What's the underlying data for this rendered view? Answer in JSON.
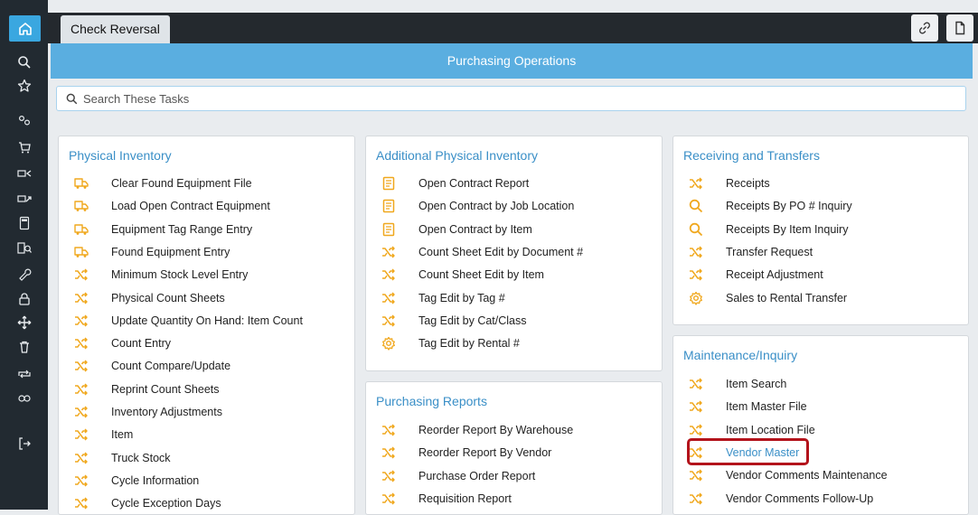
{
  "window": {
    "tab_title": "Check Reversal"
  },
  "header": {
    "title": "Purchasing Operations"
  },
  "search": {
    "placeholder": "Search These Tasks"
  },
  "colors": {
    "accent": "#3a8fc7",
    "band": "#5aaee0",
    "icon": "#f0a81e",
    "highlight": "#b3131b",
    "sidebar": "#222a31"
  },
  "panels": {
    "physical_inventory": {
      "title": "Physical Inventory",
      "items": [
        {
          "label": "Clear Found Equipment File",
          "icon": "truck-icon"
        },
        {
          "label": "Load Open Contract Equipment",
          "icon": "truck-icon"
        },
        {
          "label": "Equipment Tag Range Entry",
          "icon": "truck-icon"
        },
        {
          "label": "Found Equipment Entry",
          "icon": "truck-icon"
        },
        {
          "label": "Minimum Stock Level Entry",
          "icon": "shuffle-icon"
        },
        {
          "label": "Physical Count Sheets",
          "icon": "shuffle-icon"
        },
        {
          "label": "Update Quantity On Hand: Item Count",
          "icon": "shuffle-icon"
        },
        {
          "label": "Count Entry",
          "icon": "shuffle-icon"
        },
        {
          "label": "Count Compare/Update",
          "icon": "shuffle-icon"
        },
        {
          "label": "Reprint Count Sheets",
          "icon": "shuffle-icon"
        },
        {
          "label": "Inventory Adjustments",
          "icon": "shuffle-icon"
        },
        {
          "label": "Item",
          "icon": "shuffle-icon"
        },
        {
          "label": "Truck Stock",
          "icon": "shuffle-icon"
        },
        {
          "label": "Cycle Information",
          "icon": "shuffle-icon"
        },
        {
          "label": "Cycle Exception Days",
          "icon": "shuffle-icon"
        }
      ]
    },
    "additional_physical_inventory": {
      "title": "Additional Physical Inventory",
      "items": [
        {
          "label": "Open Contract Report",
          "icon": "report-icon"
        },
        {
          "label": "Open Contract by Job Location",
          "icon": "report-icon"
        },
        {
          "label": "Open Contract by Item",
          "icon": "report-icon"
        },
        {
          "label": "Count Sheet Edit by Document #",
          "icon": "shuffle-icon"
        },
        {
          "label": "Count Sheet Edit by Item",
          "icon": "shuffle-icon"
        },
        {
          "label": "Tag Edit by Tag #",
          "icon": "shuffle-icon"
        },
        {
          "label": "Tag Edit by Cat/Class",
          "icon": "shuffle-icon"
        },
        {
          "label": "Tag Edit by Rental #",
          "icon": "gear-icon"
        }
      ]
    },
    "purchasing_reports": {
      "title": "Purchasing Reports",
      "items": [
        {
          "label": "Reorder Report By Warehouse",
          "icon": "shuffle-icon"
        },
        {
          "label": "Reorder Report By Vendor",
          "icon": "shuffle-icon"
        },
        {
          "label": "Purchase Order Report",
          "icon": "shuffle-icon"
        },
        {
          "label": "Requisition Report",
          "icon": "shuffle-icon"
        }
      ]
    },
    "receiving_transfers": {
      "title": "Receiving and Transfers",
      "items": [
        {
          "label": "Receipts",
          "icon": "shuffle-icon"
        },
        {
          "label": "Receipts By PO # Inquiry",
          "icon": "search-icon"
        },
        {
          "label": "Receipts By Item Inquiry",
          "icon": "search-icon"
        },
        {
          "label": "Transfer Request",
          "icon": "shuffle-icon"
        },
        {
          "label": "Receipt Adjustment",
          "icon": "shuffle-icon"
        },
        {
          "label": "Sales to Rental Transfer",
          "icon": "gear-icon"
        }
      ]
    },
    "maintenance_inquiry": {
      "title": "Maintenance/Inquiry",
      "items": [
        {
          "label": "Item Search",
          "icon": "shuffle-icon"
        },
        {
          "label": "Item Master File",
          "icon": "shuffle-icon"
        },
        {
          "label": "Item Location File",
          "icon": "shuffle-icon"
        },
        {
          "label": "Vendor Master",
          "icon": "shuffle-icon"
        },
        {
          "label": "Vendor Comments Maintenance",
          "icon": "shuffle-icon"
        },
        {
          "label": "Vendor Comments Follow-Up",
          "icon": "shuffle-icon"
        }
      ]
    }
  }
}
